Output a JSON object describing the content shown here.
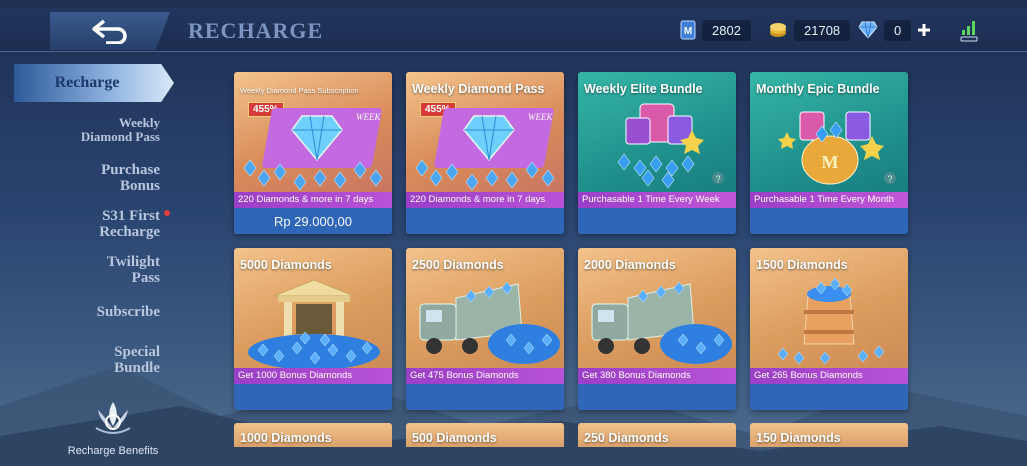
{
  "header": {
    "title": "RECHARGE",
    "back_icon": "back-arrow-icon",
    "currencies": [
      {
        "icon": "ticket-icon",
        "value": "2802",
        "color": "#4a8ee0"
      },
      {
        "icon": "gold-coin-icon",
        "value": "21708",
        "color": "#e8b93a"
      },
      {
        "icon": "diamond-icon",
        "value": "0",
        "color": "#6fb4ff"
      }
    ],
    "add_icon": "plus-icon",
    "signal_icon": "signal-icon"
  },
  "sidebar": {
    "items": [
      {
        "label": "Recharge",
        "active": true
      },
      {
        "label": "Weekly Diamond Pass"
      },
      {
        "label": "Purchase Bonus"
      },
      {
        "label": "S31 First Recharge",
        "dot": true
      },
      {
        "label": "Twilight Pass"
      },
      {
        "label": "Subscribe"
      },
      {
        "label": "Special Bundle"
      }
    ],
    "benefits_label": "Recharge Benefits"
  },
  "cards": [
    {
      "title": "Weekly Diamond Pass Subscription",
      "badge": "455%",
      "desc": "220 Diamonds & more in 7 days",
      "price": "Rp 29.000,00",
      "art": "diamond-pass-art",
      "theme": "purple"
    },
    {
      "title": "Weekly Diamond Pass",
      "badge": "455%",
      "desc": "220 Diamonds & more in 7 days",
      "price": "",
      "art": "diamond-pass-art",
      "theme": "purple"
    },
    {
      "title": "Weekly Elite Bundle",
      "desc": "Purchasable 1 Time Every Week",
      "price": "",
      "art": "elite-bundle-art",
      "theme": "teal"
    },
    {
      "title": "Monthly Epic Bundle",
      "desc": "Purchasable 1 Time Every Month",
      "price": "",
      "art": "epic-bundle-art",
      "theme": "teal"
    },
    {
      "title": "5000 Diamonds",
      "desc": "Get 1000 Bonus Diamonds",
      "price": "",
      "art": "bank-diamonds-art",
      "theme": "orange"
    },
    {
      "title": "2500 Diamonds",
      "desc": "Get 475 Bonus Diamonds",
      "price": "",
      "art": "truck-diamonds-art",
      "theme": "orange"
    },
    {
      "title": "2000 Diamonds",
      "desc": "Get 380 Bonus Diamonds",
      "price": "",
      "art": "truck-diamonds-art",
      "theme": "orange"
    },
    {
      "title": "1500 Diamonds",
      "desc": "Get 265 Bonus Diamonds",
      "price": "",
      "art": "barrel-diamonds-art",
      "theme": "orange"
    }
  ],
  "partial_cards": [
    {
      "title": "1000 Diamonds"
    },
    {
      "title": "500 Diamonds"
    },
    {
      "title": "250 Diamonds"
    },
    {
      "title": "150 Diamonds"
    }
  ],
  "card_watermark": "WEEK",
  "epic_bundle_letter": "M"
}
